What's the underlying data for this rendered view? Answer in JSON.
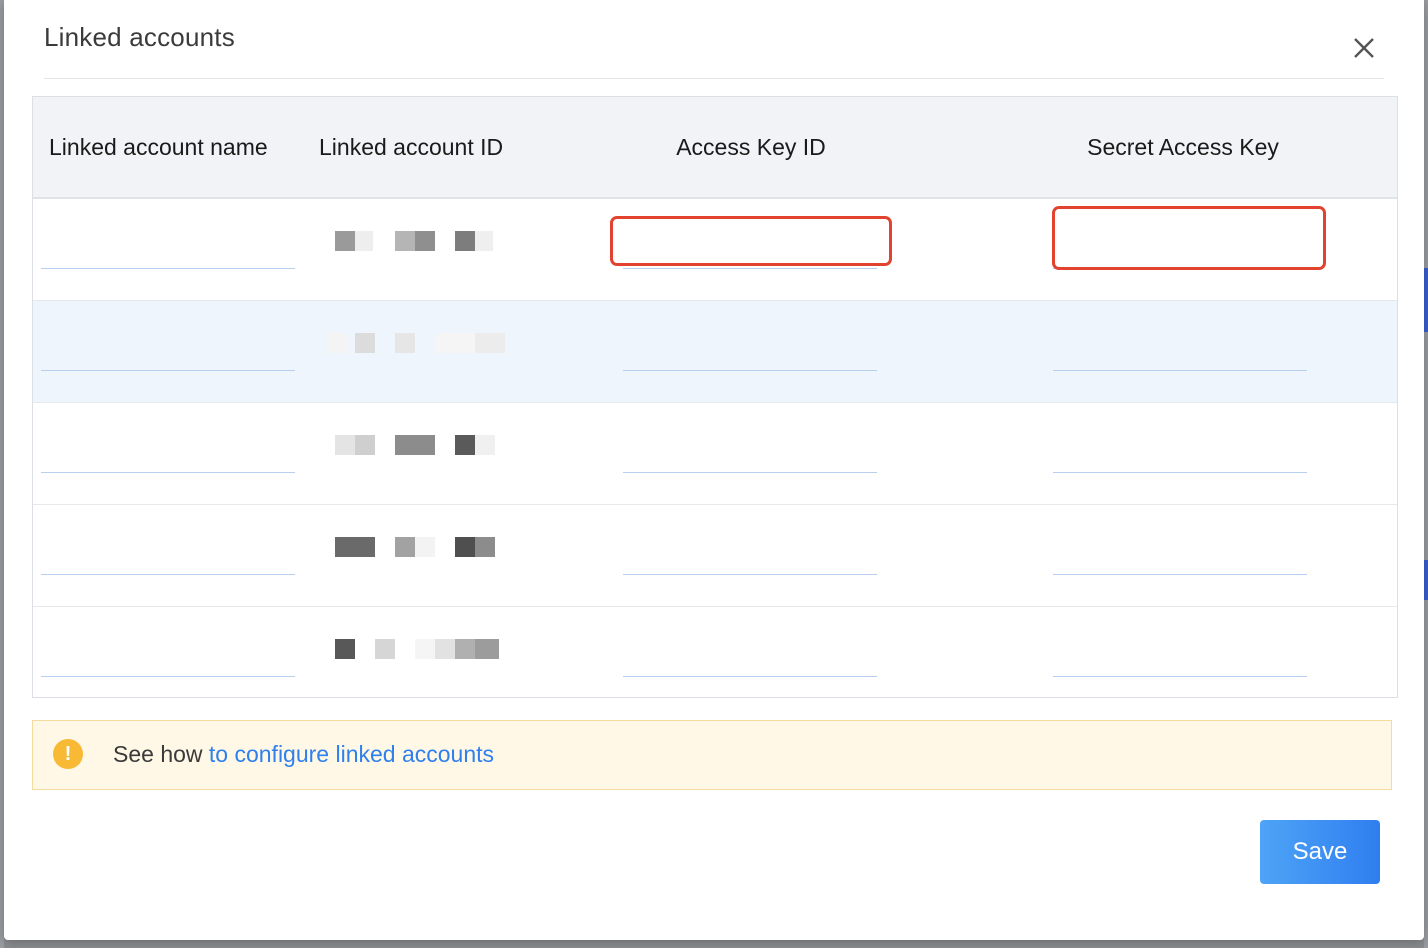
{
  "dialog": {
    "title": "Linked accounts",
    "close_icon": "close-icon"
  },
  "table": {
    "columns": [
      "Linked account name",
      "Linked account ID",
      "Access Key ID",
      "Secret Access Key"
    ],
    "rows": [
      {
        "name": "",
        "account_id": "[redacted]",
        "access_key_id": "",
        "secret_access_key": ""
      },
      {
        "name": "",
        "account_id": "[redacted]",
        "access_key_id": "",
        "secret_access_key": ""
      },
      {
        "name": "",
        "account_id": "[redacted]",
        "access_key_id": "",
        "secret_access_key": ""
      },
      {
        "name": "",
        "account_id": "[redacted]",
        "access_key_id": "",
        "secret_access_key": ""
      },
      {
        "name": "",
        "account_id": "[redacted]",
        "access_key_id": "",
        "secret_access_key": ""
      }
    ]
  },
  "notice": {
    "icon": "warning-icon",
    "prefix": "See how ",
    "link": "to configure linked accounts"
  },
  "footer": {
    "save_label": "Save"
  },
  "colors": {
    "primary": "#2f7ef0",
    "highlight_outline": "#e2432e",
    "notice_bg": "#fff8e6",
    "warning": "#f8b934",
    "link": "#2f80ed"
  }
}
